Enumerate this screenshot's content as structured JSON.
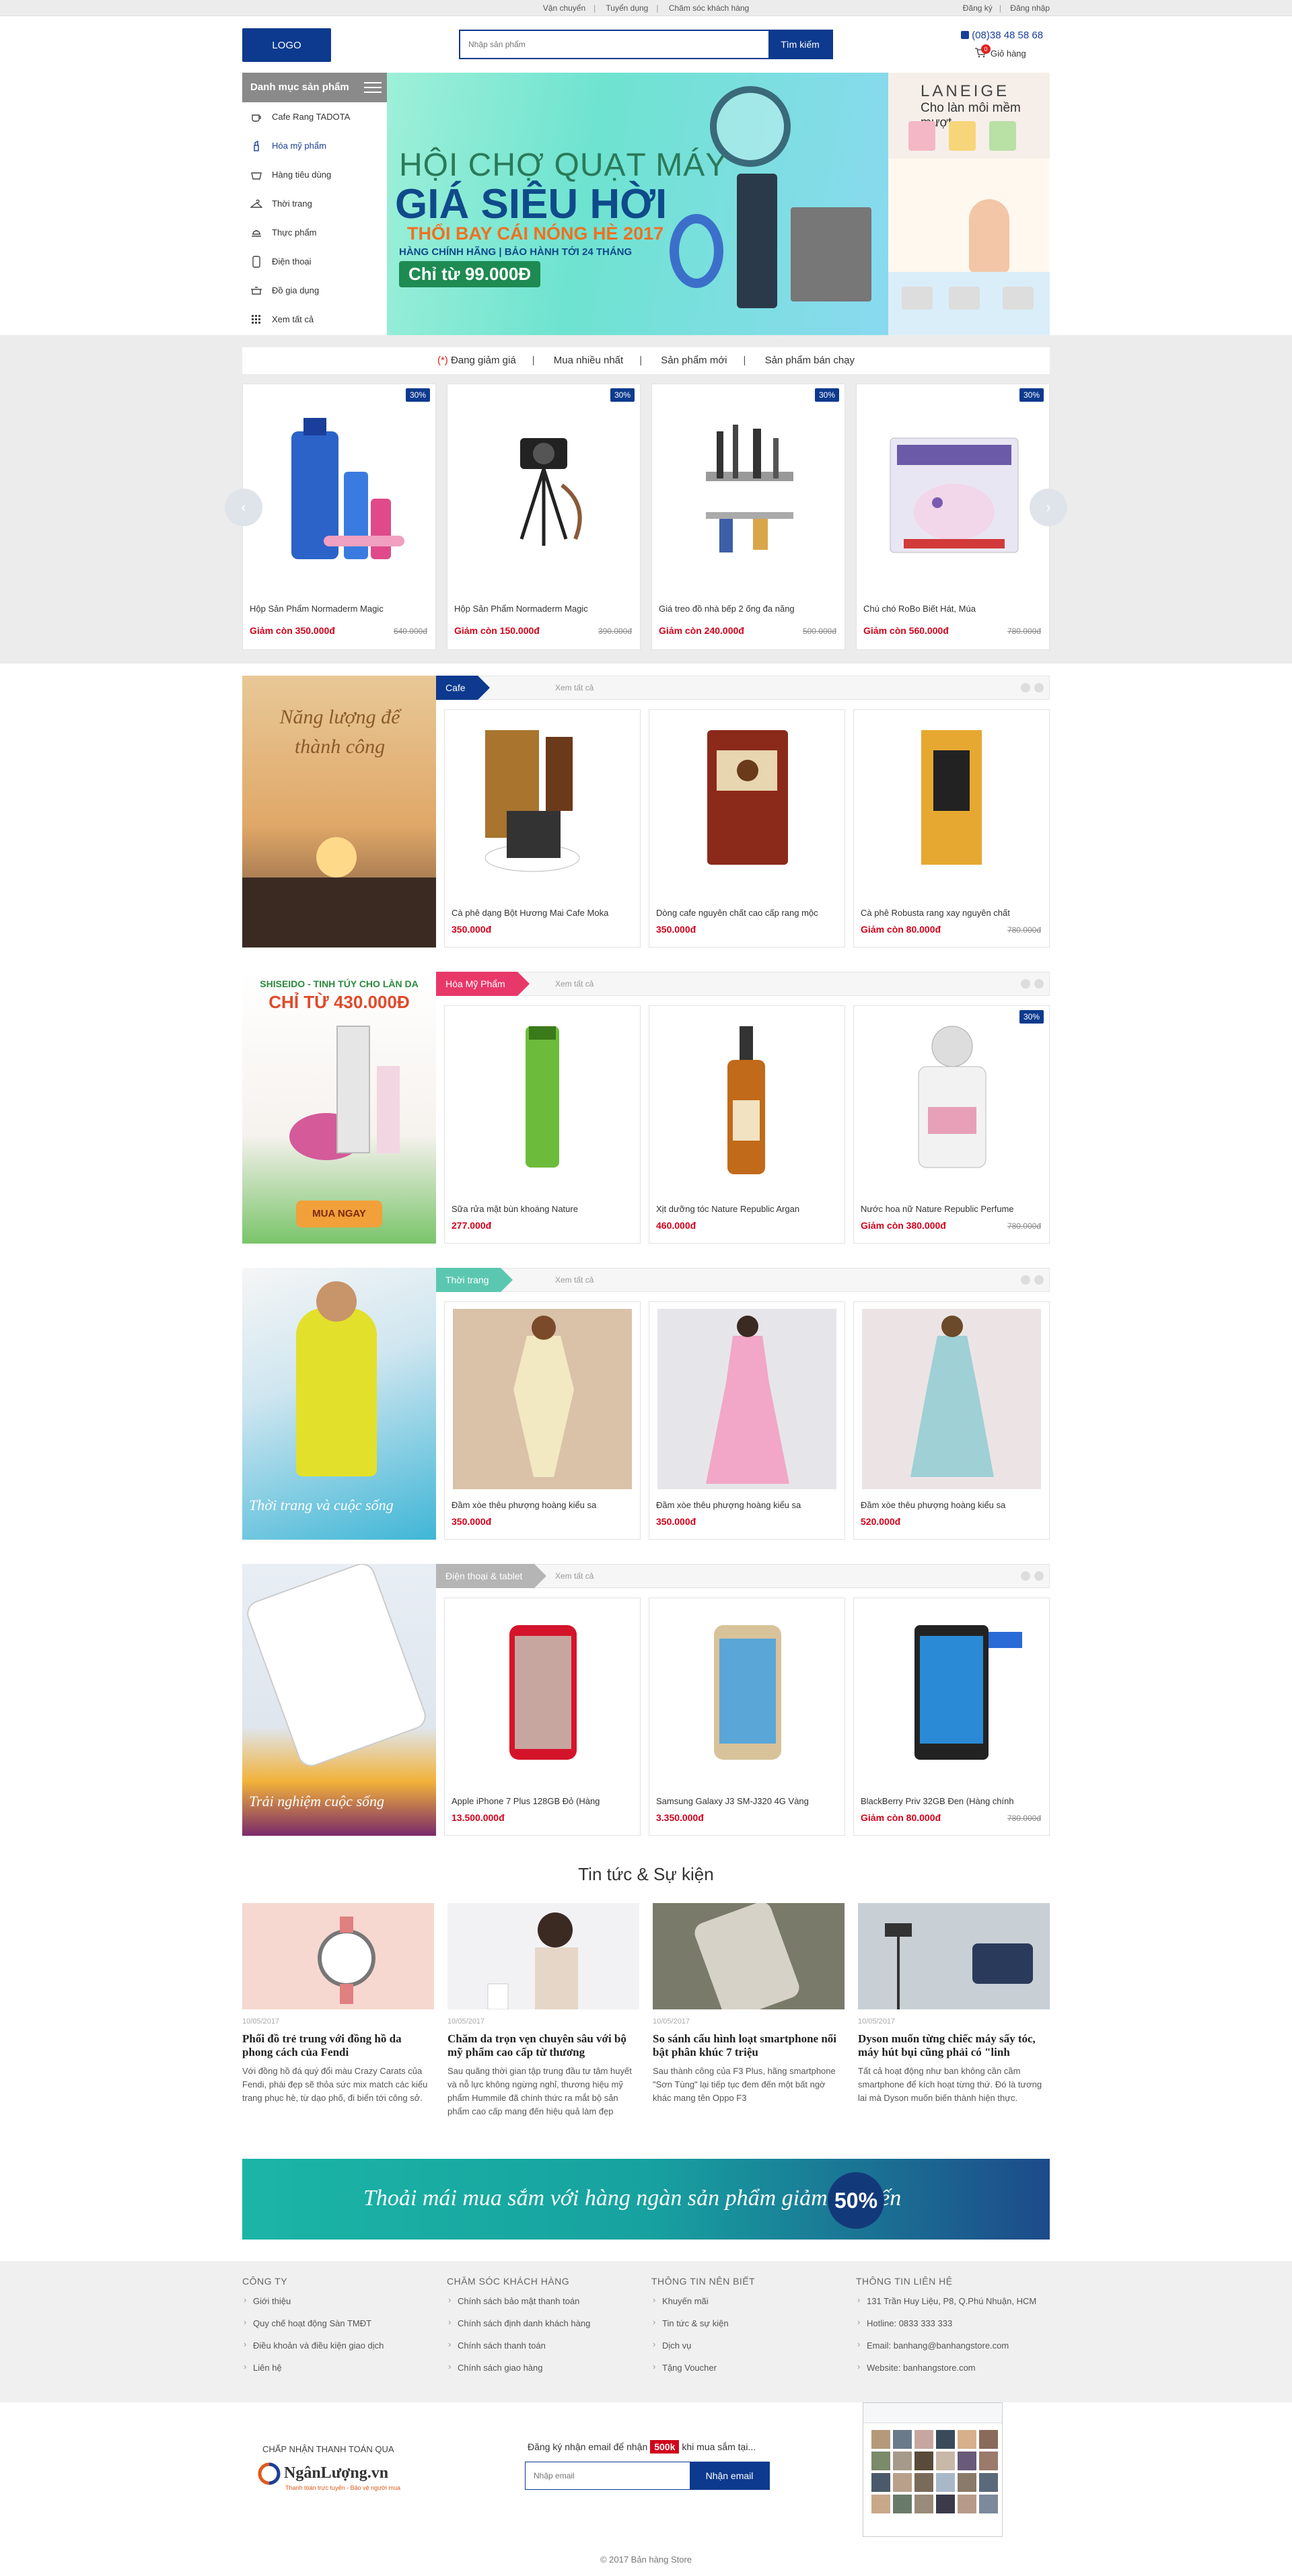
{
  "topbar": {
    "links": [
      "Vận chuyển",
      "Tuyển dụng",
      "Chăm sóc khách hàng"
    ],
    "auth": [
      "Đăng ký",
      "Đăng nhập"
    ]
  },
  "header": {
    "logo": "LOGO",
    "search_placeholder": "Nhập sản phẩm",
    "search_button": "Tìm kiếm",
    "hotline": "(08)38 48 58 68",
    "cart_label": "Giỏ hàng",
    "cart_count": "0"
  },
  "category": {
    "title": "Danh mục sản phẩm",
    "items": [
      "Cafe Rang TADOTA",
      "Hóa mỹ phẩm",
      "Hàng tiêu dùng",
      "Thời trang",
      "Thực phẩm",
      "Điện thoại",
      "Đồ gia dụng",
      "Xem tất cả"
    ],
    "active_index": 1
  },
  "banner": {
    "line1": "HỘI CHỢ QUẠT MÁY",
    "line2": "GIÁ SIÊU HỜI",
    "line3": "THỔI BAY CÁI NÓNG HÈ 2017",
    "line4": "HÀNG CHÍNH HÃNG | BẢO HÀNH TỚI 24 THÁNG",
    "line5": "Chỉ từ 99.000Đ"
  },
  "side_banner": {
    "brand": "LANEIGE",
    "tagline": "Cho làn môi mềm mượt"
  },
  "sale": {
    "tabs": [
      "Đang giảm giá",
      "Mua nhiều nhất",
      "Sản phẩm mới",
      "Sản phẩm bán chạy"
    ],
    "tab_marker": "(*)",
    "products": [
      {
        "name": "Hộp Sản Phẩm Normaderm Magic",
        "price": "Giảm còn 350.000đ",
        "old": "640.000đ",
        "badge": "30%"
      },
      {
        "name": "Hộp Sản Phẩm Normaderm Magic",
        "price": "Giảm còn 150.000đ",
        "old": "390.000đ",
        "badge": "30%"
      },
      {
        "name": "Giá treo đồ nhà bếp 2 ống đa năng",
        "price": "Giảm còn 240.000đ",
        "old": "500.000đ",
        "badge": "30%"
      },
      {
        "name": "Chú chó RoBo Biết Hát, Múa",
        "price": "Giảm còn 560.000đ",
        "old": "780.000đ",
        "badge": "30%"
      }
    ]
  },
  "blocks": [
    {
      "tag": "Cafe",
      "viewall": "Xem tất cả",
      "promo_text": "Năng lượng để thành công",
      "color": "#0d3a8e",
      "products": [
        {
          "name": "Cà phê dạng Bột Hương Mai Cafe Moka",
          "price": "350.000đ",
          "old": ""
        },
        {
          "name": "Dòng cafe nguyên chất cao cấp rang mộc",
          "price": "350.000đ",
          "old": ""
        },
        {
          "name": "Cà phê Robusta rang xay nguyên chất",
          "price": "Giảm còn 80.000đ",
          "old": "780.000đ"
        }
      ]
    },
    {
      "tag": "Hóa Mỹ Phẩm",
      "viewall": "Xem tất cả",
      "promo_text": "SHISEIDO - TINH TÚY CHO LÀN DA",
      "promo_price": "CHỈ TỪ 430.000Đ",
      "promo_btn": "MUA NGAY",
      "color": "#e8386a",
      "products": [
        {
          "name": "Sữa rửa mặt bùn khoáng Nature",
          "price": "277.000đ",
          "old": ""
        },
        {
          "name": "Xịt dưỡng tóc Nature Republic Argan",
          "price": "460.000đ",
          "old": ""
        },
        {
          "name": "Nước hoa nữ Nature Republic Perfume",
          "price": "Giảm còn 380.000đ",
          "old": "780.000đ",
          "badge": "30%"
        }
      ]
    },
    {
      "tag": "Thời trang",
      "viewall": "Xem tất cả",
      "promo_text": "Thời trang và cuộc sống",
      "color": "#5cc7b0",
      "products": [
        {
          "name": "Đầm xòe thêu phượng hoàng kiểu sa",
          "price": "350.000đ",
          "old": ""
        },
        {
          "name": "Đầm xòe thêu phượng hoàng kiểu sa",
          "price": "350.000đ",
          "old": ""
        },
        {
          "name": "Đầm xòe thêu phượng hoàng kiểu sa",
          "price": "520.000đ",
          "old": ""
        }
      ]
    },
    {
      "tag": "Điện thoại & tablet",
      "viewall": "Xem tất cả",
      "promo_text": "Trải nghiệm cuộc sống",
      "color": "#b5b5b5",
      "products": [
        {
          "name": "Apple iPhone 7 Plus 128GB Đỏ (Hàng",
          "price": "13.500.000đ",
          "old": ""
        },
        {
          "name": "Samsung Galaxy J3 SM-J320 4G Vàng",
          "price": "3.350.000đ",
          "old": ""
        },
        {
          "name": "BlackBerry Priv 32GB Đen (Hàng chính",
          "price": "Giảm còn 80.000đ",
          "old": "780.000đ"
        }
      ]
    }
  ],
  "news": {
    "title": "Tin tức & Sự kiện",
    "items": [
      {
        "date": "10/05/2017",
        "title": "Phối đồ trẻ trung với đồng hồ da phong cách của Fendi",
        "desc": "Với đồng hồ đá quý đổi màu Crazy Carats của Fendi, phái đẹp sẽ thỏa sức mix match các kiểu trang phục hè, từ dạo phố, đi biển tới công sở."
      },
      {
        "date": "10/05/2017",
        "title": "Chăm da trọn vẹn chuyên sâu với bộ mỹ phẩm cao cấp từ thương",
        "desc": "Sau quãng thời gian tập trung đầu tư tâm huyết và nỗ lực không ngừng nghỉ, thương hiệu mỹ phẩm Hummile đã chính thức ra mắt bộ sản phẩm cao cấp mang đến hiệu quả làm đẹp"
      },
      {
        "date": "10/05/2017",
        "title": "So sánh cấu hình loạt smartphone nổi bật phân khúc 7 triệu",
        "desc": "Sau thành công của F3 Plus, hãng smartphone \"Sơn Tùng\" lại tiếp tục đem đến một bất ngờ khác mang tên Oppo F3"
      },
      {
        "date": "10/05/2017",
        "title": "Dyson muốn từng chiếc máy sấy tóc, máy hút bụi cũng phải có \"linh",
        "desc": "Tất cả hoạt động như ban không cần cầm smartphone để kích hoạt từng thứ. Đó là tương lai mà Dyson muốn biến thành hiện thực."
      }
    ]
  },
  "strip": {
    "text": "Thoải mái mua sắm với hàng ngàn sản phẩm giảm giá đến",
    "percent": "50%"
  },
  "footer": {
    "cols": [
      {
        "title": "CÔNG TY",
        "items": [
          "Giới thiệu",
          "Quy chế hoạt động Sàn TMĐT",
          "Điều khoản và điều kiện giao dịch",
          "Liên hệ"
        ]
      },
      {
        "title": "CHĂM SÓC KHÁCH HÀNG",
        "items": [
          "Chính sách bảo mật thanh toán",
          "Chính sách định danh khách hàng",
          "Chính sách thanh toán",
          "Chính sách giao hàng"
        ]
      },
      {
        "title": "THÔNG TIN NÊN BIẾT",
        "items": [
          "Khuyến mãi",
          "Tin tức & sự kiện",
          "Dịch vụ",
          "Tặng Voucher"
        ]
      },
      {
        "title": "THÔNG TIN LIÊN HỆ",
        "items": [
          "131 Trần Huy Liệu, P8, Q.Phú Nhuận, HCM",
          "Hotline: 0833 333 333",
          "Email: banhang@banhangstore.com",
          "Website: banhangstore.com"
        ]
      }
    ],
    "payment_label": "CHẤP NHẬN THANH TOÁN QUA",
    "payment_brand": "NgânLượng.vn",
    "payment_slogan": "Thanh toán trực tuyến - Bảo vệ người mua",
    "subscribe_pre": "Đăng ký nhận email để nhận",
    "subscribe_amount": "500k",
    "subscribe_post": "khi mua sắm tại...",
    "email_placeholder": "Nhập email",
    "email_button": "Nhận email",
    "copyright": "© 2017 Bản hàng Store"
  },
  "colors": {
    "primary": "#0d3a8e",
    "price_red": "#d0021b"
  }
}
